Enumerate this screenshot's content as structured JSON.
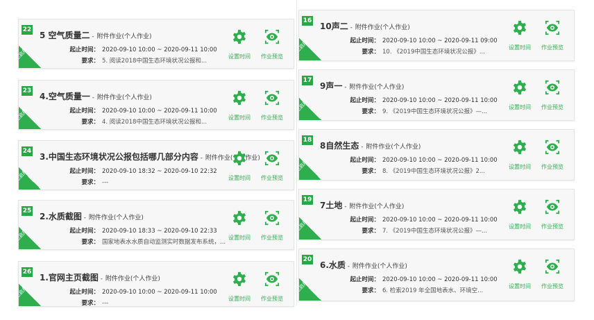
{
  "labels": {
    "corner": "已启用",
    "settings": "设置时间",
    "preview": "作业预览",
    "time_label": "起止时间：",
    "req_label": "要求：",
    "sep": " - ",
    "type": "附件作业(个人作业)"
  },
  "colors": {
    "accent": "#2fae4e",
    "badge": "#27a844"
  },
  "icons": {
    "settings": "gear-icon",
    "preview": "eye-icon"
  },
  "left": [
    {
      "num": "22",
      "title": "5 空气质量二",
      "time": "2020-09-10 10:00 ~ 2020-09-11 10:00",
      "req": "5. 阅读2018中国生态环境状况公报和..."
    },
    {
      "num": "23",
      "title": "4.空气质量一",
      "time": "2020-09-10 10:00 ~ 2020-09-11 10:00",
      "req": "4. 阅读2018中国生态环境状况公报和..."
    },
    {
      "num": "24",
      "title": "3.中国生态环境状况公报包括哪几部分内容",
      "time": "2020-09-10 18:32 ~ 2020-09-10 22:32",
      "req": "---"
    },
    {
      "num": "25",
      "title": "2.水质截图",
      "time": "2020-09-10 18:33 ~ 2020-09-10 22:33",
      "req": "国家地表水水质自动监测实时数据发布系统，..."
    },
    {
      "num": "26",
      "title": "1.官网主页截图",
      "time": "2020-09-10 10:00 ~ 2020-09-11 10:00",
      "req": "---"
    }
  ],
  "right": [
    {
      "num": "16",
      "title": "10声二",
      "time": "2020-09-10 10:00 ~ 2020-09-11 09:00",
      "req": "10. 《2019中国生态环境状况公报》..."
    },
    {
      "num": "17",
      "title": "9声一",
      "time": "2020-09-10 10:00 ~ 2020-09-11 10:00",
      "req": "9. 《2019中国生态环境状况公报》—..."
    },
    {
      "num": "18",
      "title": "8自然生态",
      "time": "2020-09-10 10:00 ~ 2020-09-11 10:00",
      "req": "8. 《2019中国生态环境状况公报》2..."
    },
    {
      "num": "19",
      "title": "7土地",
      "time": "2020-09-10 10:00 ~ 2020-09-11 10:00",
      "req": "7. 《2019中国生态环境状况公报》—..."
    },
    {
      "num": "20",
      "title": "6.水质",
      "time": "2020-09-10 10:00 ~ 2020-09-11 10:00",
      "req": "6. 检索2019 年全国地表水、环境空..."
    }
  ]
}
